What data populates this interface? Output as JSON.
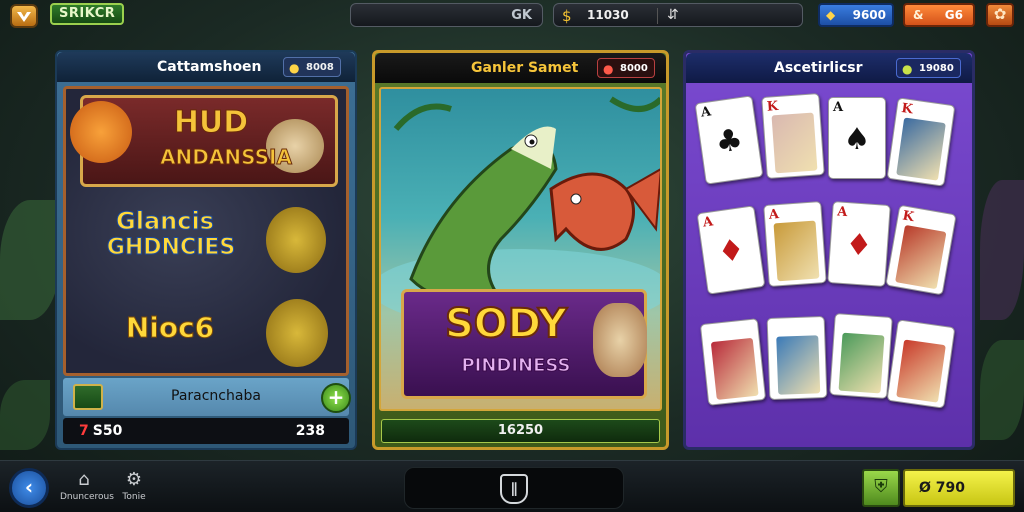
{
  "topbar": {
    "brand": "SRIKCR",
    "search_text": "GK",
    "coins_value": "11030",
    "gems_value": "9600",
    "lives_value": "G6"
  },
  "panels": [
    {
      "title": "Cattamshoen",
      "score": "8008",
      "game_titles": [
        "HUD",
        "ANDANSSIA",
        "Glancis",
        "GHDNCIES",
        "Nioc6"
      ],
      "footer_label": "Paracnchaba",
      "bottom_left": "S50",
      "bottom_left_symbol": "7",
      "bottom_right": "238"
    },
    {
      "title": "Ganler Samet",
      "score": "8000",
      "game_title_top": "SODY",
      "game_title_bottom": "PINDINESS",
      "footer_value": "16250"
    },
    {
      "title": "Ascetirlicsr",
      "score": "19080"
    }
  ],
  "cards": [
    {
      "rank": "A",
      "suit": "♣",
      "color": "#111"
    },
    {
      "rank": "K",
      "suit": "",
      "color": "#c21a1a",
      "face": "#d9b8b0"
    },
    {
      "rank": "A",
      "suit": "♠",
      "color": "#111"
    },
    {
      "rank": "K",
      "suit": "",
      "color": "#c21a1a",
      "face": "#3a6aa0"
    },
    {
      "rank": "A",
      "suit": "♦",
      "color": "#c21a1a"
    },
    {
      "rank": "A",
      "suit": "",
      "color": "#c21a1a",
      "face": "#c89a3a"
    },
    {
      "rank": "A",
      "suit": "♦",
      "color": "#c21a1a"
    },
    {
      "rank": "K",
      "suit": "",
      "color": "#c21a1a",
      "face": "#b83a2a"
    },
    {
      "rank": "",
      "suit": "",
      "color": "#c21a1a",
      "face": "#b82a3a"
    },
    {
      "rank": "",
      "suit": "",
      "color": "#c21a1a",
      "face": "#3a7ab8"
    },
    {
      "rank": "",
      "suit": "",
      "color": "#c21a1a",
      "face": "#4a9a5a"
    },
    {
      "rank": "",
      "suit": "",
      "color": "#c21a1a",
      "face": "#c83a2a"
    }
  ],
  "bottombar": {
    "nav": [
      {
        "label": "Dnuncerous",
        "icon": "house-icon"
      },
      {
        "label": "Tonie",
        "icon": "gear-icon"
      }
    ],
    "coins_value": "Ø 790"
  }
}
